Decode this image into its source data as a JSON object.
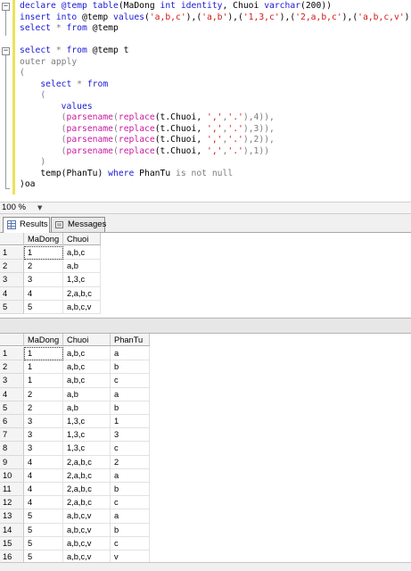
{
  "editor": {
    "lines": [
      [
        {
          "t": "declare @temp ",
          "c": "kw"
        },
        {
          "t": "table",
          "c": "kw"
        },
        {
          "t": "(MaDong ",
          "c": ""
        },
        {
          "t": "int",
          "c": "kw"
        },
        {
          "t": " ",
          "c": ""
        },
        {
          "t": "identity",
          "c": "kw"
        },
        {
          "t": ", Chuoi ",
          "c": ""
        },
        {
          "t": "varchar",
          "c": "kw"
        },
        {
          "t": "(200))",
          "c": ""
        }
      ],
      [
        {
          "t": "insert into",
          "c": "kw"
        },
        {
          "t": " @temp ",
          "c": ""
        },
        {
          "t": "values",
          "c": "kw"
        },
        {
          "t": "(",
          "c": ""
        },
        {
          "t": "'a,b,c'",
          "c": "str"
        },
        {
          "t": "),(",
          "c": ""
        },
        {
          "t": "'a,b'",
          "c": "str"
        },
        {
          "t": "),(",
          "c": ""
        },
        {
          "t": "'1,3,c'",
          "c": "str"
        },
        {
          "t": "),(",
          "c": ""
        },
        {
          "t": "'2,a,b,c'",
          "c": "str"
        },
        {
          "t": "),(",
          "c": ""
        },
        {
          "t": "'a,b,c,v'",
          "c": "str"
        },
        {
          "t": ")",
          "c": ""
        }
      ],
      [
        {
          "t": "select",
          "c": "kw"
        },
        {
          "t": " * ",
          "c": "gr"
        },
        {
          "t": "from",
          "c": "kw"
        },
        {
          "t": " @temp",
          "c": ""
        }
      ],
      [],
      [
        {
          "t": "select",
          "c": "kw"
        },
        {
          "t": " * ",
          "c": "gr"
        },
        {
          "t": "from",
          "c": "kw"
        },
        {
          "t": " @temp t",
          "c": ""
        }
      ],
      [
        {
          "t": "outer apply",
          "c": "gr"
        }
      ],
      [
        {
          "t": "(",
          "c": "gr"
        }
      ],
      [
        {
          "t": "    ",
          "c": ""
        },
        {
          "t": "select",
          "c": "kw"
        },
        {
          "t": " * ",
          "c": "gr"
        },
        {
          "t": "from",
          "c": "kw"
        }
      ],
      [
        {
          "t": "    ",
          "c": ""
        },
        {
          "t": "(",
          "c": "gr"
        }
      ],
      [
        {
          "t": "        ",
          "c": ""
        },
        {
          "t": "values",
          "c": "kw"
        }
      ],
      [
        {
          "t": "        ",
          "c": ""
        },
        {
          "t": "(",
          "c": "gr"
        },
        {
          "t": "parsename",
          "c": "fn"
        },
        {
          "t": "(",
          "c": "gr"
        },
        {
          "t": "replace",
          "c": "fn"
        },
        {
          "t": "(t.Chuoi, ",
          "c": ""
        },
        {
          "t": "','",
          "c": "str"
        },
        {
          "t": ",",
          "c": "gr"
        },
        {
          "t": "'.'",
          "c": "str"
        },
        {
          "t": "),4)),",
          "c": "gr"
        }
      ],
      [
        {
          "t": "        ",
          "c": ""
        },
        {
          "t": "(",
          "c": "gr"
        },
        {
          "t": "parsename",
          "c": "fn"
        },
        {
          "t": "(",
          "c": "gr"
        },
        {
          "t": "replace",
          "c": "fn"
        },
        {
          "t": "(t.Chuoi, ",
          "c": ""
        },
        {
          "t": "','",
          "c": "str"
        },
        {
          "t": ",",
          "c": "gr"
        },
        {
          "t": "'.'",
          "c": "str"
        },
        {
          "t": "),3)),",
          "c": "gr"
        }
      ],
      [
        {
          "t": "        ",
          "c": ""
        },
        {
          "t": "(",
          "c": "gr"
        },
        {
          "t": "parsename",
          "c": "fn"
        },
        {
          "t": "(",
          "c": "gr"
        },
        {
          "t": "replace",
          "c": "fn"
        },
        {
          "t": "(t.Chuoi, ",
          "c": ""
        },
        {
          "t": "','",
          "c": "str"
        },
        {
          "t": ",",
          "c": "gr"
        },
        {
          "t": "'.'",
          "c": "str"
        },
        {
          "t": "),2)),",
          "c": "gr"
        }
      ],
      [
        {
          "t": "        ",
          "c": ""
        },
        {
          "t": "(",
          "c": "gr"
        },
        {
          "t": "parsename",
          "c": "fn"
        },
        {
          "t": "(",
          "c": "gr"
        },
        {
          "t": "replace",
          "c": "fn"
        },
        {
          "t": "(t.Chuoi, ",
          "c": ""
        },
        {
          "t": "','",
          "c": "str"
        },
        {
          "t": ",",
          "c": "gr"
        },
        {
          "t": "'.'",
          "c": "str"
        },
        {
          "t": "),1))",
          "c": "gr"
        }
      ],
      [
        {
          "t": "    ",
          "c": ""
        },
        {
          "t": ")",
          "c": "gr"
        }
      ],
      [
        {
          "t": "    temp(PhanTu) ",
          "c": ""
        },
        {
          "t": "where",
          "c": "kw"
        },
        {
          "t": " PhanTu ",
          "c": ""
        },
        {
          "t": "is not null",
          "c": "gr"
        }
      ],
      [
        {
          "t": ")oa",
          "c": ""
        }
      ]
    ]
  },
  "status": {
    "zoom": "100 %"
  },
  "tabs": [
    {
      "label": "Results",
      "active": true,
      "icon": "grid-icon"
    },
    {
      "label": "Messages",
      "active": false,
      "icon": "messages-icon"
    }
  ],
  "grid1": {
    "columns": [
      "MaDong",
      "Chuoi"
    ],
    "rows": [
      [
        "1",
        "1",
        "a,b,c"
      ],
      [
        "2",
        "2",
        "a,b"
      ],
      [
        "3",
        "3",
        "1,3,c"
      ],
      [
        "4",
        "4",
        "2,a,b,c"
      ],
      [
        "5",
        "5",
        "a,b,c,v"
      ]
    ]
  },
  "grid2": {
    "columns": [
      "MaDong",
      "Chuoi",
      "PhanTu"
    ],
    "rows": [
      [
        "1",
        "1",
        "a,b,c",
        "a"
      ],
      [
        "2",
        "1",
        "a,b,c",
        "b"
      ],
      [
        "3",
        "1",
        "a,b,c",
        "c"
      ],
      [
        "4",
        "2",
        "a,b",
        "a"
      ],
      [
        "5",
        "2",
        "a,b",
        "b"
      ],
      [
        "6",
        "3",
        "1,3,c",
        "1"
      ],
      [
        "7",
        "3",
        "1,3,c",
        "3"
      ],
      [
        "8",
        "3",
        "1,3,c",
        "c"
      ],
      [
        "9",
        "4",
        "2,a,b,c",
        "2"
      ],
      [
        "10",
        "4",
        "2,a,b,c",
        "a"
      ],
      [
        "11",
        "4",
        "2,a,b,c",
        "b"
      ],
      [
        "12",
        "4",
        "2,a,b,c",
        "c"
      ],
      [
        "13",
        "5",
        "a,b,c,v",
        "a"
      ],
      [
        "14",
        "5",
        "a,b,c,v",
        "b"
      ],
      [
        "15",
        "5",
        "a,b,c,v",
        "c"
      ],
      [
        "16",
        "5",
        "a,b,c,v",
        "v"
      ]
    ]
  }
}
